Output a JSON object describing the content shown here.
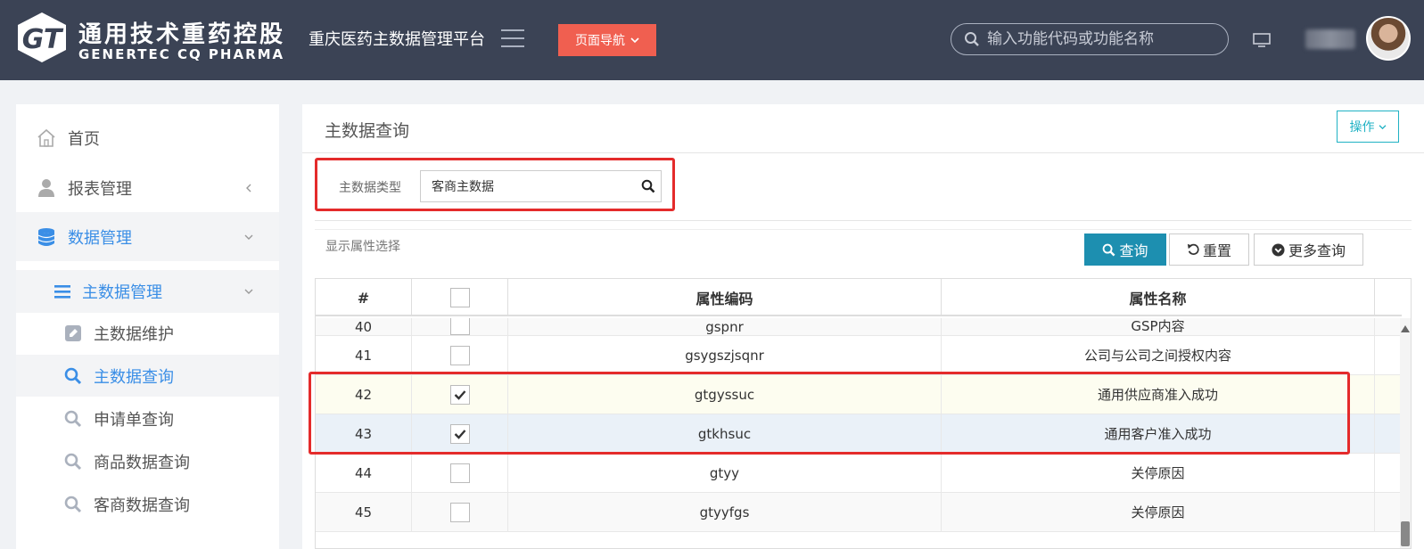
{
  "header": {
    "logo_cn": "通用技术重药控股",
    "logo_en": "GENERTEC CQ PHARMA",
    "platform_title": "重庆医药主数据管理平台",
    "nav_button": "页面导航",
    "search_placeholder": "输入功能代码或功能名称"
  },
  "sidebar": {
    "items": [
      {
        "label": "首页",
        "icon": "home-icon"
      },
      {
        "label": "报表管理",
        "icon": "user-icon"
      },
      {
        "label": "数据管理",
        "icon": "database-icon"
      }
    ],
    "group": {
      "label": "主数据管理",
      "icon": "list-icon"
    },
    "sub_items": [
      {
        "label": "主数据维护",
        "icon": "edit-icon"
      },
      {
        "label": "主数据查询",
        "icon": "search-icon"
      },
      {
        "label": "申请单查询",
        "icon": "search-icon"
      },
      {
        "label": "商品数据查询",
        "icon": "search-icon"
      },
      {
        "label": "客商数据查询",
        "icon": "search-icon"
      }
    ]
  },
  "main": {
    "title": "主数据查询",
    "ops_button": "操作",
    "filter": {
      "label": "主数据类型",
      "value": "客商主数据"
    },
    "attr_label": "显示属性选择",
    "buttons": {
      "query": "查询",
      "reset": "重置",
      "more": "更多查询"
    },
    "table": {
      "headers": [
        "#",
        "",
        "属性编码",
        "属性名称"
      ],
      "rows": [
        {
          "num": "40",
          "checked": false,
          "code": "gspnr",
          "name": "GSP内容"
        },
        {
          "num": "41",
          "checked": false,
          "code": "gsygszjsqnr",
          "name": "公司与公司之间授权内容"
        },
        {
          "num": "42",
          "checked": true,
          "code": "gtgyssuc",
          "name": "通用供应商准入成功"
        },
        {
          "num": "43",
          "checked": true,
          "code": "gtkhsuc",
          "name": "通用客户准入成功"
        },
        {
          "num": "44",
          "checked": false,
          "code": "gtyy",
          "name": "关停原因"
        },
        {
          "num": "45",
          "checked": false,
          "code": "gtyyfgs",
          "name": "关停原因"
        }
      ]
    }
  },
  "colors": {
    "topbar": "#3b4355",
    "accent_blue": "#3a8ee6",
    "nav_red": "#f05f50",
    "query_btn": "#1d8fb0",
    "highlight_box": "#e42b2b"
  }
}
